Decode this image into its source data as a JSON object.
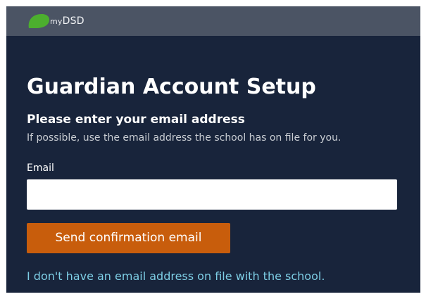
{
  "header": {
    "logo_prefix": "my",
    "logo_name": "DSD",
    "logo_color": "#4caf2e",
    "bar_color": "#4b5464"
  },
  "main": {
    "title": "Guardian Account Setup",
    "subtitle": "Please enter your email address",
    "hint": "If possible, use the email address the school has on file for you.",
    "email_label": "Email",
    "email_value": "",
    "send_button_label": "Send confirmation email",
    "no_email_link": "I don't have an email address on file with the school.",
    "background_color": "#18243b",
    "button_color": "#c85d0c",
    "link_color": "#7ecfe6"
  }
}
